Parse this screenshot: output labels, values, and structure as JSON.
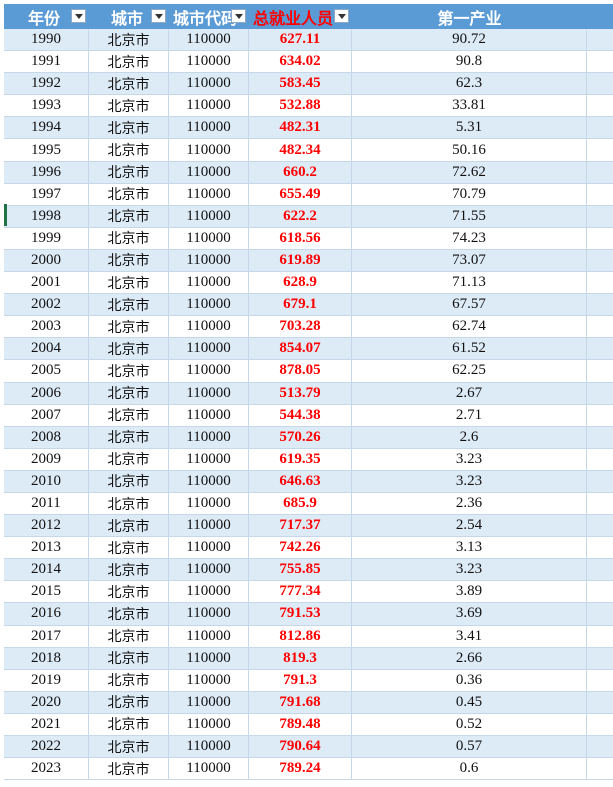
{
  "headers": {
    "year": "年份",
    "city": "城市",
    "city_code": "城市代码",
    "total_employment": "总就业人员",
    "primary_industry": "第一产业"
  },
  "rows": [
    {
      "year": "1990",
      "city": "北京市",
      "code": "110000",
      "emp": "627.11",
      "primary": "90.72"
    },
    {
      "year": "1991",
      "city": "北京市",
      "code": "110000",
      "emp": "634.02",
      "primary": "90.8"
    },
    {
      "year": "1992",
      "city": "北京市",
      "code": "110000",
      "emp": "583.45",
      "primary": "62.3"
    },
    {
      "year": "1993",
      "city": "北京市",
      "code": "110000",
      "emp": "532.88",
      "primary": "33.81"
    },
    {
      "year": "1994",
      "city": "北京市",
      "code": "110000",
      "emp": "482.31",
      "primary": "5.31"
    },
    {
      "year": "1995",
      "city": "北京市",
      "code": "110000",
      "emp": "482.34",
      "primary": "50.16"
    },
    {
      "year": "1996",
      "city": "北京市",
      "code": "110000",
      "emp": "660.2",
      "primary": "72.62"
    },
    {
      "year": "1997",
      "city": "北京市",
      "code": "110000",
      "emp": "655.49",
      "primary": "70.79"
    },
    {
      "year": "1998",
      "city": "北京市",
      "code": "110000",
      "emp": "622.2",
      "primary": "71.55"
    },
    {
      "year": "1999",
      "city": "北京市",
      "code": "110000",
      "emp": "618.56",
      "primary": "74.23"
    },
    {
      "year": "2000",
      "city": "北京市",
      "code": "110000",
      "emp": "619.89",
      "primary": "73.07"
    },
    {
      "year": "2001",
      "city": "北京市",
      "code": "110000",
      "emp": "628.9",
      "primary": "71.13"
    },
    {
      "year": "2002",
      "city": "北京市",
      "code": "110000",
      "emp": "679.1",
      "primary": "67.57"
    },
    {
      "year": "2003",
      "city": "北京市",
      "code": "110000",
      "emp": "703.28",
      "primary": "62.74"
    },
    {
      "year": "2004",
      "city": "北京市",
      "code": "110000",
      "emp": "854.07",
      "primary": "61.52"
    },
    {
      "year": "2005",
      "city": "北京市",
      "code": "110000",
      "emp": "878.05",
      "primary": "62.25"
    },
    {
      "year": "2006",
      "city": "北京市",
      "code": "110000",
      "emp": "513.79",
      "primary": "2.67"
    },
    {
      "year": "2007",
      "city": "北京市",
      "code": "110000",
      "emp": "544.38",
      "primary": "2.71"
    },
    {
      "year": "2008",
      "city": "北京市",
      "code": "110000",
      "emp": "570.26",
      "primary": "2.6"
    },
    {
      "year": "2009",
      "city": "北京市",
      "code": "110000",
      "emp": "619.35",
      "primary": "3.23"
    },
    {
      "year": "2010",
      "city": "北京市",
      "code": "110000",
      "emp": "646.63",
      "primary": "3.23"
    },
    {
      "year": "2011",
      "city": "北京市",
      "code": "110000",
      "emp": "685.9",
      "primary": "2.36"
    },
    {
      "year": "2012",
      "city": "北京市",
      "code": "110000",
      "emp": "717.37",
      "primary": "2.54"
    },
    {
      "year": "2013",
      "city": "北京市",
      "code": "110000",
      "emp": "742.26",
      "primary": "3.13"
    },
    {
      "year": "2014",
      "city": "北京市",
      "code": "110000",
      "emp": "755.85",
      "primary": "3.23"
    },
    {
      "year": "2015",
      "city": "北京市",
      "code": "110000",
      "emp": "777.34",
      "primary": "3.89"
    },
    {
      "year": "2016",
      "city": "北京市",
      "code": "110000",
      "emp": "791.53",
      "primary": "3.69"
    },
    {
      "year": "2017",
      "city": "北京市",
      "code": "110000",
      "emp": "812.86",
      "primary": "3.41"
    },
    {
      "year": "2018",
      "city": "北京市",
      "code": "110000",
      "emp": "819.3",
      "primary": "2.66"
    },
    {
      "year": "2019",
      "city": "北京市",
      "code": "110000",
      "emp": "791.3",
      "primary": "0.36"
    },
    {
      "year": "2020",
      "city": "北京市",
      "code": "110000",
      "emp": "791.68",
      "primary": "0.45"
    },
    {
      "year": "2021",
      "city": "北京市",
      "code": "110000",
      "emp": "789.48",
      "primary": "0.52"
    },
    {
      "year": "2022",
      "city": "北京市",
      "code": "110000",
      "emp": "790.64",
      "primary": "0.57"
    },
    {
      "year": "2023",
      "city": "北京市",
      "code": "110000",
      "emp": "789.24",
      "primary": "0.6"
    }
  ],
  "colors": {
    "header_bg": "#5b9bd5",
    "band": "#ddebf7",
    "emphasis": "#ff0000"
  }
}
